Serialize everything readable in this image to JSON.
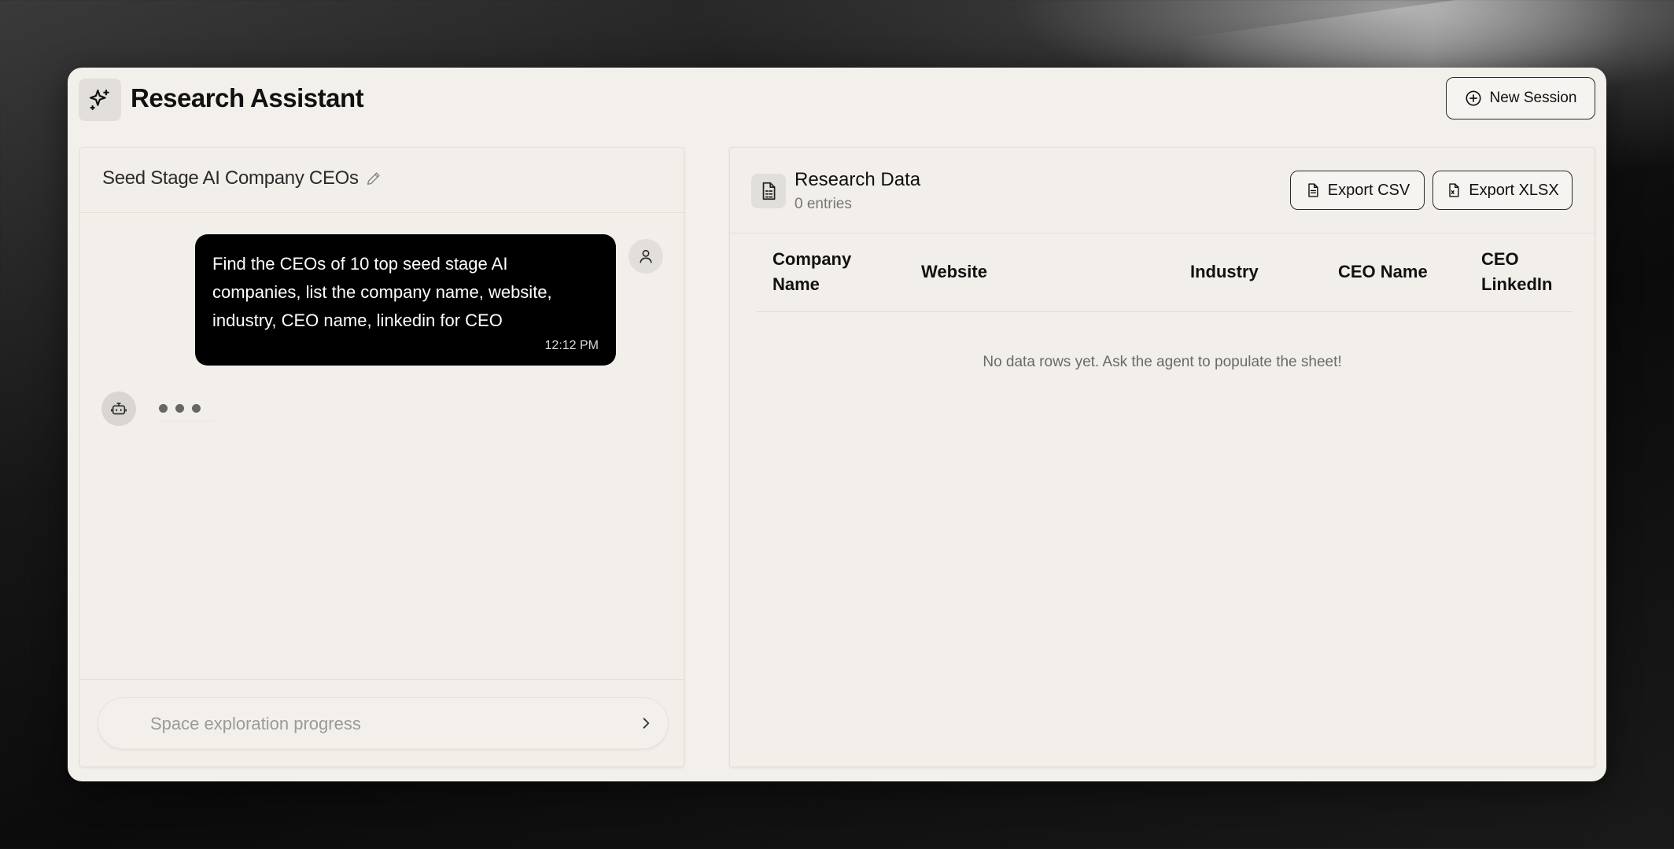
{
  "app": {
    "title": "Research Assistant",
    "new_session_label": "New Session"
  },
  "chat": {
    "title": "Seed Stage AI Company CEOs",
    "messages": [
      {
        "role": "user",
        "text": "Find the CEOs of 10 top seed stage AI companies, list the company name, website, industry, CEO name, linkedin for CEO",
        "time": "12:12 PM"
      }
    ],
    "input_placeholder": "Space exploration progress"
  },
  "data": {
    "title": "Research Data",
    "count_label": "0 entries",
    "export_csv_label": "Export CSV",
    "export_xlsx_label": "Export XLSX",
    "columns": [
      "Company Name",
      "Website",
      "Industry",
      "CEO Name",
      "CEO LinkedIn"
    ],
    "rows": [],
    "empty_message": "No data rows yet. Ask the agent to populate the sheet!"
  },
  "icons": {
    "logo": "sparkles-icon",
    "new_session": "plus-circle-icon",
    "edit": "pencil-icon",
    "user": "user-icon",
    "bot": "bot-icon",
    "send": "chevron-right-icon",
    "data": "spreadsheet-file-icon",
    "export_csv": "file-text-icon",
    "export_xlsx": "file-spreadsheet-icon"
  }
}
